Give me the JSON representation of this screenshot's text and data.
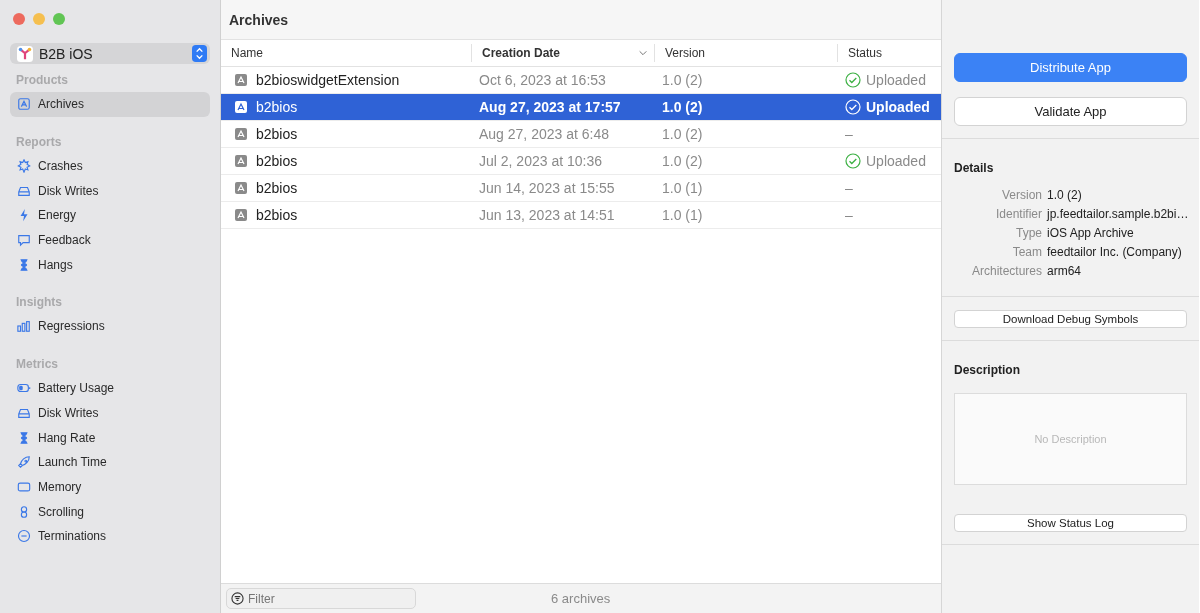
{
  "project": {
    "name": "B2B iOS"
  },
  "sidebar": [
    {
      "title": "Products",
      "items": [
        {
          "label": "Archives",
          "kind": "archive",
          "selected": true
        }
      ]
    },
    {
      "title": "Reports",
      "items": [
        {
          "label": "Crashes",
          "kind": "crash",
          "selected": false
        },
        {
          "label": "Disk Writes",
          "kind": "disk",
          "selected": false
        },
        {
          "label": "Energy",
          "kind": "energy",
          "selected": false
        },
        {
          "label": "Feedback",
          "kind": "feedback",
          "selected": false
        },
        {
          "label": "Hangs",
          "kind": "hang",
          "selected": false
        }
      ]
    },
    {
      "title": "Insights",
      "items": [
        {
          "label": "Regressions",
          "kind": "regression",
          "selected": false
        }
      ]
    },
    {
      "title": "Metrics",
      "items": [
        {
          "label": "Battery Usage",
          "kind": "battery",
          "selected": false
        },
        {
          "label": "Disk Writes",
          "kind": "disk",
          "selected": false
        },
        {
          "label": "Hang Rate",
          "kind": "hang",
          "selected": false
        },
        {
          "label": "Launch Time",
          "kind": "launch",
          "selected": false
        },
        {
          "label": "Memory",
          "kind": "memory",
          "selected": false
        },
        {
          "label": "Scrolling",
          "kind": "scroll",
          "selected": false
        },
        {
          "label": "Terminations",
          "kind": "termination",
          "selected": false
        }
      ]
    }
  ],
  "table": {
    "title": "Archives",
    "columns": [
      {
        "label": "Name",
        "sorted": false
      },
      {
        "label": "Creation Date",
        "sorted": true
      },
      {
        "label": "Version",
        "sorted": false
      },
      {
        "label": "Status",
        "sorted": false
      }
    ],
    "rows": [
      {
        "name": "b2bioswidgetExtension",
        "date": "Oct 6, 2023 at 16:53",
        "version": "1.0 (2)",
        "status": "Uploaded",
        "kind": "uploaded",
        "selected": false
      },
      {
        "name": "b2bios",
        "date": "Aug 27, 2023 at 17:57",
        "version": "1.0 (2)",
        "status": "Uploaded",
        "kind": "uploaded",
        "selected": true
      },
      {
        "name": "b2bios",
        "date": "Aug 27, 2023 at 6:48",
        "version": "1.0 (2)",
        "status": "–",
        "kind": "none",
        "selected": false
      },
      {
        "name": "b2bios",
        "date": "Jul 2, 2023 at 10:36",
        "version": "1.0 (2)",
        "status": "Uploaded",
        "kind": "uploaded",
        "selected": false
      },
      {
        "name": "b2bios",
        "date": "Jun 14, 2023 at 15:55",
        "version": "1.0 (1)",
        "status": "–",
        "kind": "none",
        "selected": false
      },
      {
        "name": "b2bios",
        "date": "Jun 13, 2023 at 14:51",
        "version": "1.0 (1)",
        "status": "–",
        "kind": "none",
        "selected": false
      }
    ]
  },
  "footer": {
    "filter_placeholder": "Filter",
    "count": "6 archives"
  },
  "inspector": {
    "primary_button": "Distribute App",
    "secondary_button": "Validate App",
    "details_title": "Details",
    "details": [
      {
        "key": "Version",
        "value": "1.0 (2)"
      },
      {
        "key": "Identifier",
        "value": "jp.feedtailor.sample.b2bi…"
      },
      {
        "key": "Type",
        "value": "iOS App Archive"
      },
      {
        "key": "Team",
        "value": "feedtailor Inc. (Company)"
      },
      {
        "key": "Architectures",
        "value": "arm64"
      }
    ],
    "symbols_button": "Download Debug Symbols",
    "description_title": "Description",
    "description_placeholder": "No Description",
    "status_log_button": "Show Status Log"
  }
}
